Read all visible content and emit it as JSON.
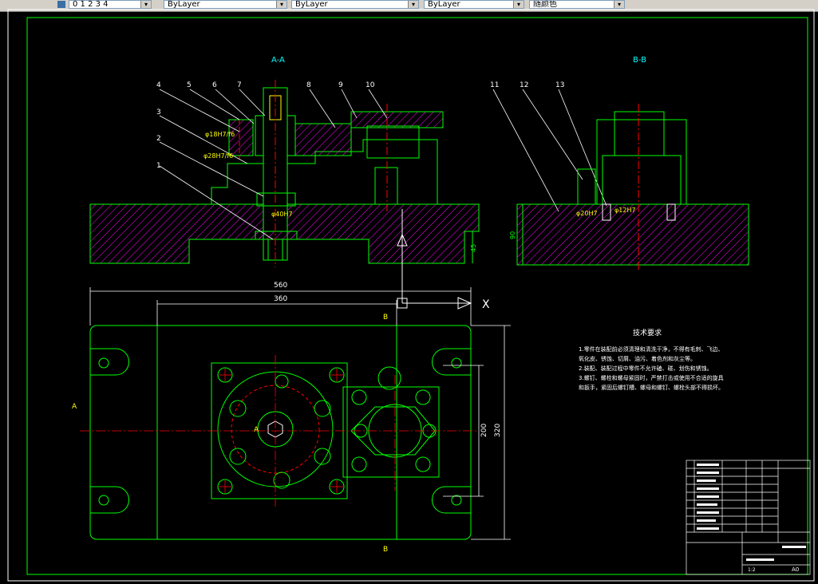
{
  "toolbar": {
    "combos": [
      {
        "value": "0 1 2 3 4"
      },
      {
        "value": "ByLayer"
      },
      {
        "value": "ByLayer"
      },
      {
        "value": "ByLayer"
      },
      {
        "value": "随颜色"
      }
    ]
  },
  "drawing": {
    "view_aa_label": "A-A",
    "view_bb_label": "B-B",
    "callouts": [
      "1",
      "2",
      "3",
      "4",
      "5",
      "6",
      "7",
      "8",
      "9",
      "10",
      "11",
      "12",
      "13"
    ],
    "dims": {
      "d560": "560",
      "d360": "360",
      "d200": "200",
      "d320": "320",
      "d45": "45",
      "d90": "90",
      "fit_phi18": "φ18H7/f6",
      "fit_phi28": "φ28H7/f6",
      "fit_phi40": "φ40H7",
      "fit_phi20": "φ20H7",
      "fit_phi12": "φ12H7"
    },
    "section_marks": {
      "a_left": "A",
      "a_center": "A",
      "b_top": "B",
      "b_bottom": "B"
    },
    "axis_x": "X",
    "tech_req": {
      "title": "技术要求",
      "lines": [
        "1.零件在装配前必须清理和清洗干净，不得有毛刺、飞边、",
        "氧化皮、锈蚀、切屑、油污、着色剂和灰尘等。",
        "2.装配、装配过程中零件不允许磕、碰、划伤和锈蚀。",
        "3.螺钉、螺栓和螺母紧固时，严禁打击或使用不合适的旋具",
        "和扳手，紧固后螺钉槽、螺母和螺钉、螺栓头部不得损坏。"
      ]
    },
    "title_block": {
      "scale": "1:2",
      "sheet": "A0"
    }
  },
  "colors": {
    "green": "#00ff00",
    "yellow": "#ffff00",
    "white": "#ffffff",
    "red": "#ff0000",
    "magenta": "#ff00ff",
    "cyan": "#00ffff"
  }
}
